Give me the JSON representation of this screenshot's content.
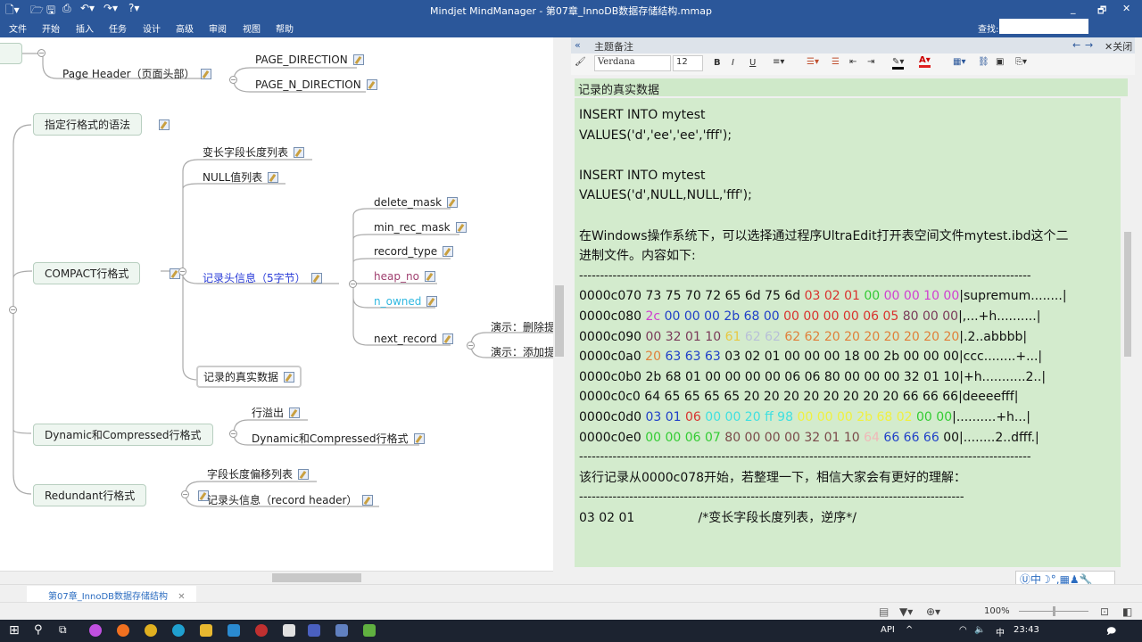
{
  "window": {
    "title": "Mindjet MindManager - 第07章_InnoDB数据存储结构.mmap",
    "minimize": "_",
    "restore": "🗗",
    "close": "✕"
  },
  "menu": [
    "文件",
    "开始",
    "插入",
    "任务",
    "设计",
    "高级",
    "审阅",
    "视图",
    "帮助"
  ],
  "find": {
    "label": "查找:",
    "value": ""
  },
  "mindmap": {
    "page_header": "Page Header（页面头部）",
    "page_direction": "PAGE_DIRECTION",
    "page_n_direction": "PAGE_N_DIRECTION",
    "row_format_syntax": "指定行格式的语法",
    "compact": "COMPACT行格式",
    "var_len_list": "变长字段长度列表",
    "null_list": "NULL值列表",
    "record_header": "记录头信息（5字节）",
    "delete_mask": "delete_mask",
    "min_rec_mask": "min_rec_mask",
    "record_type": "record_type",
    "heap_no": "heap_no",
    "n_owned": "n_owned",
    "next_record": "next_record",
    "demo_delete": "演示：删除提",
    "demo_add": "演示：添加提",
    "real_data": "记录的真实数据",
    "dynamic": "Dynamic和Compressed行格式",
    "overflow": "行溢出",
    "dynamic_child": "Dynamic和Compressed行格式",
    "redundant": "Redundant行格式",
    "field_offset": "字段长度偏移列表",
    "redundant_header": "记录头信息（record header）"
  },
  "notes": {
    "panel_title": "主题备注",
    "close_label": "关闭",
    "font": "Verdana",
    "size": "12",
    "bold": "B",
    "italic": "I",
    "underline": "U",
    "topic": "记录的真实数据",
    "lines": [
      "INSERT INTO mytest",
      "VALUES('d','ee','ee','fff');",
      "",
      "INSERT INTO mytest",
      "VALUES('d',NULL,NULL,'fff');",
      "",
      "在Windows操作系统下，可以选择通过程序UltraEdit打开表空间文件mytest.ibd这个二",
      "进制文件。内容如下:"
    ],
    "separator": "------------------------------------------------------------------------------------------------------------",
    "hex_rows": [
      [
        {
          "t": "0000c070 73 75 70 72 65 6d 75 6d ",
          "c": "#111111"
        },
        {
          "t": "03 02 01 ",
          "c": "#d9332e"
        },
        {
          "t": "00 ",
          "c": "#33cc33"
        },
        {
          "t": "00 00 10 00",
          "c": "#d040d0"
        },
        {
          "t": "|supremum........|",
          "c": "#111111"
        }
      ],
      [
        {
          "t": "0000c080 ",
          "c": "#111111"
        },
        {
          "t": "2c ",
          "c": "#d040d0"
        },
        {
          "t": "00 00 00 2b 68 00 ",
          "c": "#2040c8"
        },
        {
          "t": "00 00 00 00 06 05 ",
          "c": "#d9332e"
        },
        {
          "t": "80 00 00",
          "c": "#7a3a5a"
        },
        {
          "t": "|,...+h..........|",
          "c": "#111111"
        }
      ],
      [
        {
          "t": "0000c090 ",
          "c": "#111111"
        },
        {
          "t": "00 32 01 10 ",
          "c": "#7a3a5a"
        },
        {
          "t": "61 ",
          "c": "#e8c840"
        },
        {
          "t": "62 62 ",
          "c": "#b8c0d8"
        },
        {
          "t": "62 62 20 20 20 20 20 20 20",
          "c": "#e0803a"
        },
        {
          "t": "|.2..abbbb|",
          "c": "#111111"
        }
      ],
      [
        {
          "t": "0000c0a0 ",
          "c": "#111111"
        },
        {
          "t": "20 ",
          "c": "#e0803a"
        },
        {
          "t": "63 63 63 ",
          "c": "#2040c8"
        },
        {
          "t": "03 02 01 00 00 00 18 00 2b 00 00 00|ccc........+...|",
          "c": "#111111"
        }
      ],
      [
        {
          "t": "0000c0b0 2b 68 01 00 00 00 00 06 06 80 00 00 00 32 01 10|+h...........2..|",
          "c": "#111111"
        }
      ],
      [
        {
          "t": "0000c0c0 64 65 65 65 65 20 20 20 20 20 20 20 20 66 66 66|deeeefff|",
          "c": "#111111"
        }
      ],
      [
        {
          "t": "0000c0d0 ",
          "c": "#111111"
        },
        {
          "t": "03 01 ",
          "c": "#2040c8"
        },
        {
          "t": "06 ",
          "c": "#d9332e"
        },
        {
          "t": "00 00 20 ff 98 ",
          "c": "#40e0e0"
        },
        {
          "t": "00 00 00 2b 68 02 ",
          "c": "#f0f040"
        },
        {
          "t": "00 00",
          "c": "#33cc33"
        },
        {
          "t": "|..........+h...|",
          "c": "#111111"
        }
      ],
      [
        {
          "t": "0000c0e0 ",
          "c": "#111111"
        },
        {
          "t": "00 00 06 07 ",
          "c": "#33cc33"
        },
        {
          "t": "80 00 00 00 32 01 10 ",
          "c": "#7a4a4a"
        },
        {
          "t": "64 ",
          "c": "#f0b8b8"
        },
        {
          "t": "66 66 66 ",
          "c": "#2040c8"
        },
        {
          "t": "00|........2..dfff.|",
          "c": "#111111"
        }
      ]
    ],
    "after_lines": [
      "该行记录从0000c078开始，若整理一下，相信大家会有更好的理解："
    ],
    "separator2": "--------------------------------------------------------------------------------------------",
    "last_line": "03 02 01                /*变长字段长度列表，逆序*/"
  },
  "tab": {
    "label": "第07章_InnoDB数据存储结构"
  },
  "status": {
    "zoom": "100%"
  },
  "taskbar": {
    "api": "API",
    "ime": "中",
    "time": "23:43"
  }
}
